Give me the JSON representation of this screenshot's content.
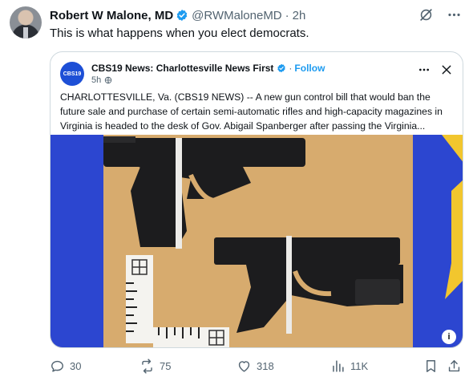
{
  "tweet": {
    "author_name": "Robert W Malone, MD",
    "handle": "@RWMaloneMD",
    "separator": "·",
    "time": "2h",
    "text": "This is what happens when you elect democrats."
  },
  "card": {
    "logo_text": "CBS19",
    "source_name": "CBS19 News: Charlottesville News First",
    "follow_separator": "·",
    "follow_label": "Follow",
    "time": "5h",
    "body": "CHARLOTTESVILLE, Va. (CBS19 NEWS) -- A new gun control bill that would ban the future sale and purchase of certain semi-automatic rifles and high-capacity magazines in Virginia is headed to the desk of Gov. Abigail Spanberger after passing the Virginia...",
    "info_badge": "i",
    "photo_colors": {
      "background": "#d7ab6e",
      "left_stripe": "#2c46d0",
      "right_stripe": "#2c46d0",
      "accent": "#f2c62e",
      "pistol": "#1c1c1e"
    }
  },
  "actions": {
    "replies": "30",
    "reposts": "75",
    "likes": "318",
    "views": "11K"
  },
  "colors": {
    "text": "#0f1419",
    "muted": "#536471",
    "accent": "#1d9bf0",
    "border": "#cfd9de"
  },
  "icons": [
    "verified-badge-icon",
    "grok-icon",
    "more-icon",
    "globe-icon",
    "close-icon",
    "reply-icon",
    "repost-icon",
    "like-icon",
    "views-icon",
    "bookmark-icon",
    "share-icon"
  ]
}
